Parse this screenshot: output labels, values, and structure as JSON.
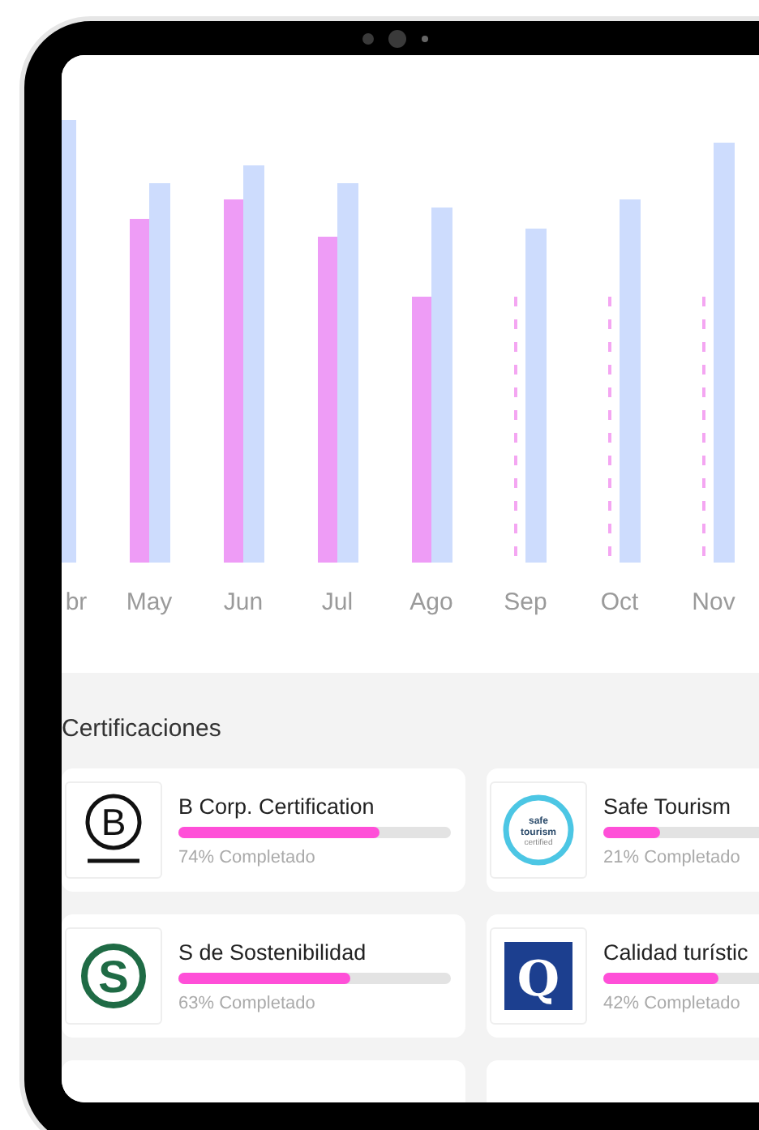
{
  "chart": {
    "months": [
      "br",
      "May",
      "Jun",
      "Jul",
      "Ago",
      "Sep",
      "Oct",
      "Nov"
    ]
  },
  "certifications": {
    "title": "Certificaciones",
    "items": [
      {
        "kind": "bcorp",
        "logo_text": [
          "B"
        ],
        "name": "B Corp. Certification",
        "level": 0.74,
        "progress": "74% Completado"
      },
      {
        "kind": "safe",
        "logo_text": [
          "safe",
          "tourism",
          "certified"
        ],
        "name": "Safe Tourism",
        "level": 0.21,
        "progress": "21% Completado"
      },
      {
        "kind": "s",
        "logo_text": [
          "S"
        ],
        "name": "S de Sostenibilidad",
        "level": 0.63,
        "progress": "63% Completado"
      },
      {
        "kind": "q",
        "logo_text": [
          "Q"
        ],
        "name": "Calidad turístic",
        "level": 0.42,
        "progress": "42% Completado"
      }
    ]
  }
}
